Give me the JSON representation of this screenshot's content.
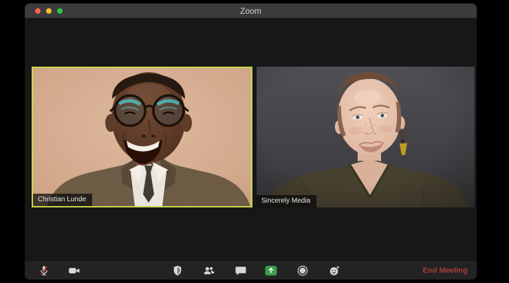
{
  "window": {
    "title": "Zoom"
  },
  "traffic_lights": [
    {
      "name": "close-button",
      "color": "#ff5f57"
    },
    {
      "name": "minimize-button",
      "color": "#febc2e"
    },
    {
      "name": "maximize-button",
      "color": "#28c840"
    }
  ],
  "participants": [
    {
      "name": "Christian Lunde",
      "active_speaker": true,
      "description": "smiling man with round glasses, brown tweed jacket, white shirt, dark tie, peach wall background"
    },
    {
      "name": "Sincerely Media",
      "active_speaker": false,
      "description": "woman with short buzzed brown hair, olive v-neck top, geometric earring, dark gray background"
    }
  ],
  "toolbar": {
    "items": [
      {
        "id": "mute",
        "icon": "microphone-muted-icon",
        "state": "muted"
      },
      {
        "id": "video",
        "icon": "video-camera-icon"
      },
      {
        "id": "security",
        "icon": "shield-icon"
      },
      {
        "id": "participants",
        "icon": "participants-icon"
      },
      {
        "id": "chat",
        "icon": "chat-bubble-icon"
      },
      {
        "id": "share-screen",
        "icon": "share-screen-icon"
      },
      {
        "id": "record",
        "icon": "record-icon"
      },
      {
        "id": "reactions",
        "icon": "reactions-smiley-icon"
      }
    ],
    "end_meeting_label": "End Meeting"
  },
  "colors": {
    "titlebar_bg": "#3b3a3d",
    "content_bg": "#171717",
    "toolbar_bg": "#232324",
    "active_speaker_border": "#c7d84c",
    "end_meeting_red": "#a93e36",
    "share_green": "#3aa04a",
    "mute_slash_red": "#c0392b"
  }
}
